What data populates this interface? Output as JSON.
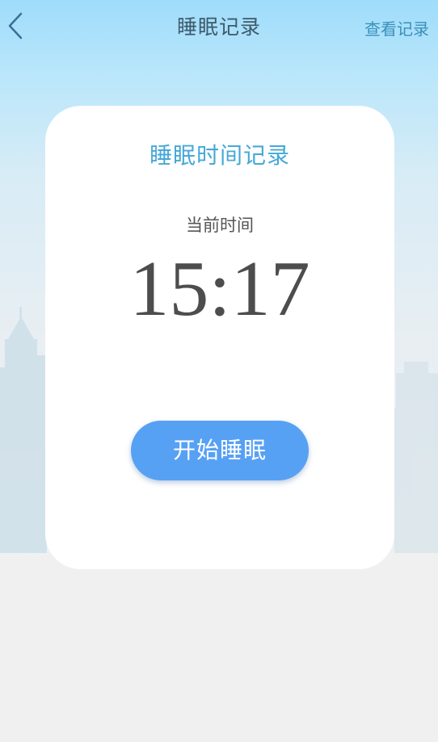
{
  "header": {
    "back_icon": "chevron-left-icon",
    "title": "睡眠记录",
    "view_records_label": "查看记录"
  },
  "card": {
    "title": "睡眠时间记录",
    "time_label": "当前时间",
    "time_value": "15:17",
    "start_button_label": "开始睡眠"
  },
  "colors": {
    "accent": "#45a8d8",
    "button": "#57a1f4",
    "sky": "#9fdcfb",
    "background": "#f0f0f0"
  }
}
